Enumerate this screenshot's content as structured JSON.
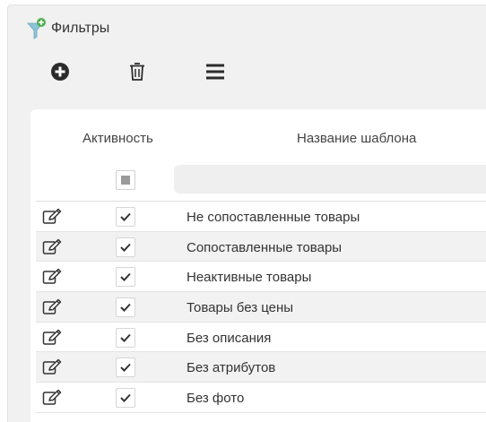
{
  "panel": {
    "title": "Фильтры",
    "title_icon": "filter-plus-icon"
  },
  "toolbar": {
    "buttons": [
      {
        "name": "add-button",
        "icon": "plus-circle-icon"
      },
      {
        "name": "delete-button",
        "icon": "trash-icon"
      },
      {
        "name": "menu-button",
        "icon": "hamburger-icon"
      }
    ]
  },
  "table": {
    "columns": [
      "Активность",
      "Название шаблона"
    ],
    "filter": {
      "activity_state": "indeterminate",
      "name_placeholder": ""
    },
    "rows": [
      {
        "active": true,
        "name": "Не сопоставленные товары"
      },
      {
        "active": true,
        "name": "Сопоставленные товары"
      },
      {
        "active": true,
        "name": "Неактивные товары"
      },
      {
        "active": true,
        "name": "Товары без цены"
      },
      {
        "active": true,
        "name": "Без описания"
      },
      {
        "active": true,
        "name": "Без атрибутов"
      },
      {
        "active": true,
        "name": "Без фото"
      }
    ]
  },
  "colors": {
    "panel_bg": "#f1f1f1",
    "card_bg": "#ffffff",
    "alt_row_bg": "#f2f2f2",
    "icon_dark": "#2b2b2b",
    "funnel_accent": "#7fb7c9",
    "plus_accent": "#4caf50"
  }
}
